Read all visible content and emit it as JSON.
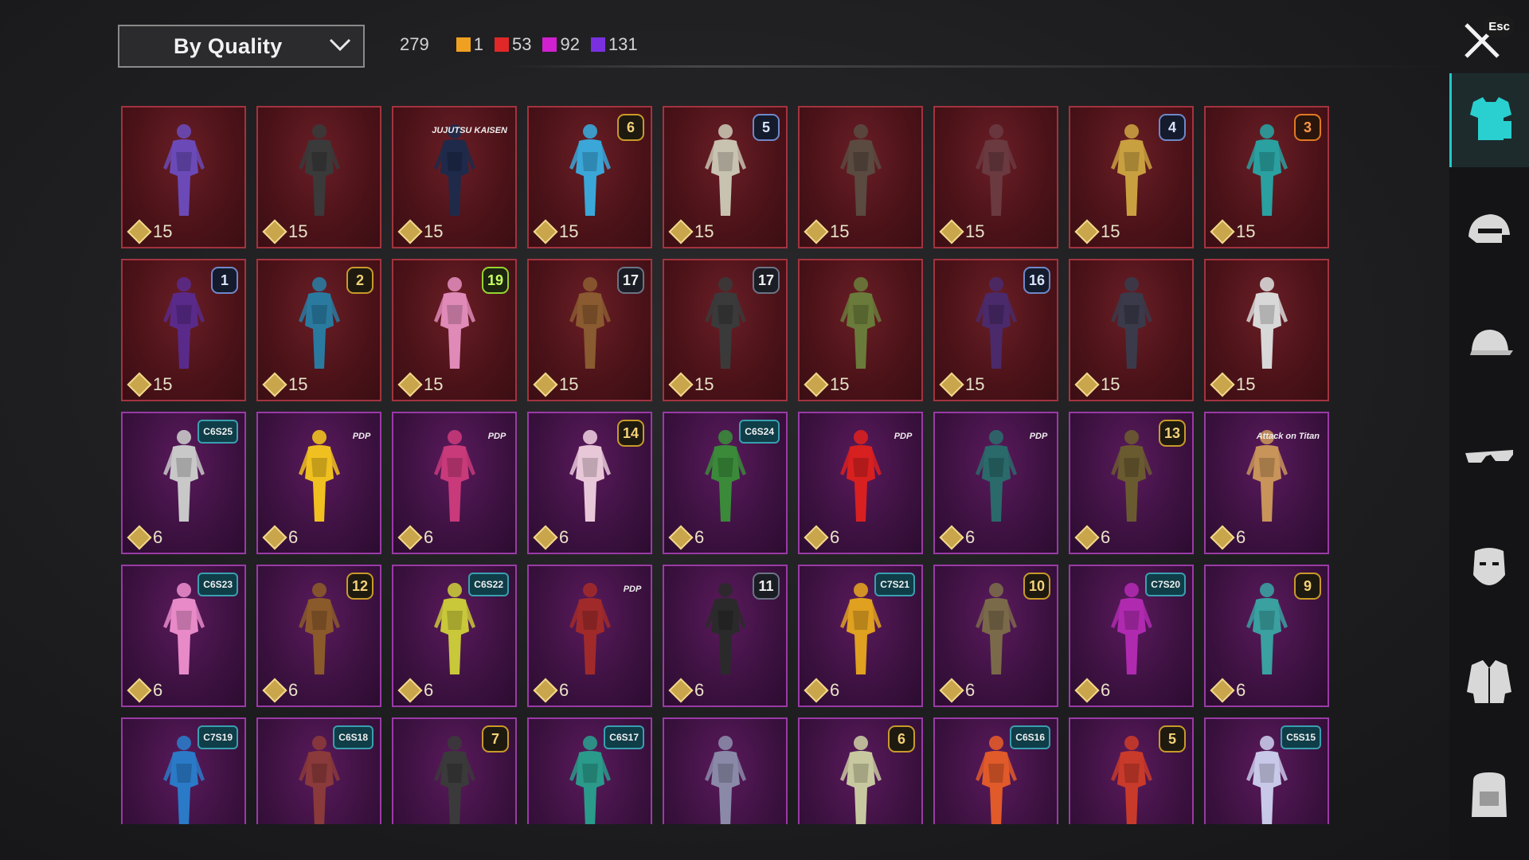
{
  "filter": {
    "label": "By Quality"
  },
  "counts": {
    "total": "279",
    "items": [
      {
        "color": "#f0a020",
        "value": "1"
      },
      {
        "color": "#e02828",
        "value": "53"
      },
      {
        "color": "#d020d0",
        "value": "92"
      },
      {
        "color": "#7a30e0",
        "value": "131"
      }
    ]
  },
  "close": {
    "esc_label": "Esc"
  },
  "sidebar": {
    "items": [
      {
        "icon": "outfit-icon",
        "active": true
      },
      {
        "icon": "helmet-icon",
        "active": false
      },
      {
        "icon": "cap-icon",
        "active": false
      },
      {
        "icon": "glasses-icon",
        "active": false
      },
      {
        "icon": "mask-icon",
        "active": false
      },
      {
        "icon": "jacket-icon",
        "active": false
      },
      {
        "icon": "backpack-icon",
        "active": false
      }
    ]
  },
  "items": [
    {
      "rarity": "red",
      "price": "15",
      "badge": "",
      "badge_style": "",
      "color": "#6b4ab8"
    },
    {
      "rarity": "red",
      "price": "15",
      "badge": "",
      "badge_style": "",
      "color": "#3a3a3a"
    },
    {
      "rarity": "red",
      "price": "15",
      "badge": "JUJUTSU KAISEN",
      "badge_style": "txt",
      "color": "#1f2a4a"
    },
    {
      "rarity": "red",
      "price": "15",
      "badge": "6",
      "badge_style": "gold",
      "color": "#3aa7d8"
    },
    {
      "rarity": "red",
      "price": "15",
      "badge": "5",
      "badge_style": "blue",
      "color": "#c8c2b0"
    },
    {
      "rarity": "red",
      "price": "15",
      "badge": "",
      "badge_style": "",
      "color": "#5a4a40"
    },
    {
      "rarity": "red",
      "price": "15",
      "badge": "",
      "badge_style": "",
      "color": "#6a3a40"
    },
    {
      "rarity": "red",
      "price": "15",
      "badge": "4",
      "badge_style": "blue",
      "color": "#c9a040"
    },
    {
      "rarity": "red",
      "price": "15",
      "badge": "3",
      "badge_style": "orange",
      "color": "#2aa0a0"
    },
    {
      "rarity": "red",
      "price": "15",
      "badge": "1",
      "badge_style": "blue",
      "color": "#5a2a8a"
    },
    {
      "rarity": "red",
      "price": "15",
      "badge": "2",
      "badge_style": "gold",
      "color": "#2a7aa0"
    },
    {
      "rarity": "red",
      "price": "15",
      "badge": "19",
      "badge_style": "green",
      "color": "#e08ab8"
    },
    {
      "rarity": "red",
      "price": "15",
      "badge": "17",
      "badge_style": "",
      "color": "#8a5a30"
    },
    {
      "rarity": "red",
      "price": "15",
      "badge": "17",
      "badge_style": "",
      "color": "#3a3a3a"
    },
    {
      "rarity": "red",
      "price": "15",
      "badge": "",
      "badge_style": "",
      "color": "#6a7a3a"
    },
    {
      "rarity": "red",
      "price": "15",
      "badge": "16",
      "badge_style": "blue",
      "color": "#4a2a6a"
    },
    {
      "rarity": "red",
      "price": "15",
      "badge": "",
      "badge_style": "",
      "color": "#3a3a4a"
    },
    {
      "rarity": "red",
      "price": "15",
      "badge": "",
      "badge_style": "",
      "color": "#d8d8d8"
    },
    {
      "rarity": "purple",
      "price": "6",
      "badge": "C6S25",
      "badge_style": "hexb",
      "color": "#c8c8c8"
    },
    {
      "rarity": "purple",
      "price": "6",
      "badge": "PDP",
      "badge_style": "txt",
      "color": "#f0c020"
    },
    {
      "rarity": "purple",
      "price": "6",
      "badge": "PDP",
      "badge_style": "txt",
      "color": "#c83a7a"
    },
    {
      "rarity": "purple",
      "price": "6",
      "badge": "14",
      "badge_style": "gold",
      "color": "#e8c8d8"
    },
    {
      "rarity": "purple",
      "price": "6",
      "badge": "C6S24",
      "badge_style": "hexb",
      "color": "#3a8a3a"
    },
    {
      "rarity": "purple",
      "price": "6",
      "badge": "PDP",
      "badge_style": "txt",
      "color": "#d82020"
    },
    {
      "rarity": "purple",
      "price": "6",
      "badge": "PDP",
      "badge_style": "txt",
      "color": "#2a6a6a"
    },
    {
      "rarity": "purple",
      "price": "6",
      "badge": "13",
      "badge_style": "gold",
      "color": "#6a5a30"
    },
    {
      "rarity": "purple",
      "price": "6",
      "badge": "Attack on Titan",
      "badge_style": "txt",
      "color": "#c8945a"
    },
    {
      "rarity": "purple",
      "price": "6",
      "badge": "C6S23",
      "badge_style": "hexb",
      "color": "#e88ac8"
    },
    {
      "rarity": "purple",
      "price": "6",
      "badge": "12",
      "badge_style": "gold",
      "color": "#8a5a2a"
    },
    {
      "rarity": "purple",
      "price": "6",
      "badge": "C6S22",
      "badge_style": "hexb",
      "color": "#c8c83a"
    },
    {
      "rarity": "purple",
      "price": "6",
      "badge": "PDP",
      "badge_style": "txt",
      "color": "#a02a2a"
    },
    {
      "rarity": "purple",
      "price": "6",
      "badge": "11",
      "badge_style": "",
      "color": "#2a2a2a"
    },
    {
      "rarity": "purple",
      "price": "6",
      "badge": "C7S21",
      "badge_style": "hexb",
      "color": "#e0a020"
    },
    {
      "rarity": "purple",
      "price": "6",
      "badge": "10",
      "badge_style": "gold",
      "color": "#7a6a4a"
    },
    {
      "rarity": "purple",
      "price": "6",
      "badge": "C7S20",
      "badge_style": "hexb",
      "color": "#b02ab0"
    },
    {
      "rarity": "purple",
      "price": "6",
      "badge": "9",
      "badge_style": "gold",
      "color": "#3aa0a0"
    },
    {
      "rarity": "purple",
      "price": "",
      "badge": "C7S19",
      "badge_style": "hexb",
      "color": "#2a7ac8"
    },
    {
      "rarity": "purple",
      "price": "",
      "badge": "C6S18",
      "badge_style": "hexb",
      "color": "#8a3a3a"
    },
    {
      "rarity": "purple",
      "price": "",
      "badge": "7",
      "badge_style": "gold",
      "color": "#3a3a3a"
    },
    {
      "rarity": "purple",
      "price": "",
      "badge": "C6S17",
      "badge_style": "hexb",
      "color": "#2a9a8a"
    },
    {
      "rarity": "purple",
      "price": "",
      "badge": "",
      "badge_style": "",
      "color": "#8a8aa8"
    },
    {
      "rarity": "purple",
      "price": "",
      "badge": "6",
      "badge_style": "gold",
      "color": "#c8c8a0"
    },
    {
      "rarity": "purple",
      "price": "",
      "badge": "C6S16",
      "badge_style": "hexb",
      "color": "#e05a2a"
    },
    {
      "rarity": "purple",
      "price": "",
      "badge": "5",
      "badge_style": "gold",
      "color": "#c83a2a"
    },
    {
      "rarity": "purple",
      "price": "",
      "badge": "C5S15",
      "badge_style": "hexb",
      "color": "#c8c8e8"
    }
  ]
}
